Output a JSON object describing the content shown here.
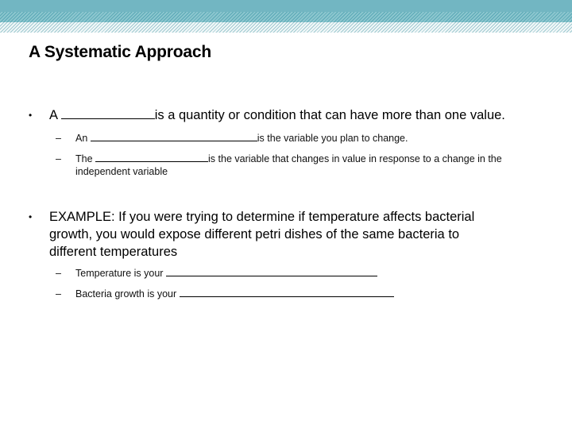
{
  "slide": {
    "title": "A Systematic Approach",
    "bullets": [
      {
        "marker": "•",
        "prefix": "A ",
        "blank": "____________",
        "suffix": "is a quantity or condition that can have more than one value.",
        "subitems": [
          {
            "marker": "–",
            "prefix": "An ",
            "blank": "__________________________",
            "suffix": "is the variable you plan to change."
          },
          {
            "marker": "–",
            "prefix": "The ",
            "blank": "__________________",
            "suffix": "is the variable that changes in value in response to a change in the",
            "continuation": "independent variable"
          }
        ]
      },
      {
        "marker": "•",
        "lines": [
          "EXAMPLE:  If you were trying to determine if temperature affects bacterial",
          "growth, you would expose different petri dishes of the same bacteria to",
          "different temperatures"
        ],
        "subitems": [
          {
            "marker": "–",
            "prefix": "Temperature is your ",
            "blank": "_________________________________"
          },
          {
            "marker": "–",
            "prefix": "Bacteria growth is your ",
            "blank": "_________________________________"
          }
        ]
      }
    ]
  }
}
